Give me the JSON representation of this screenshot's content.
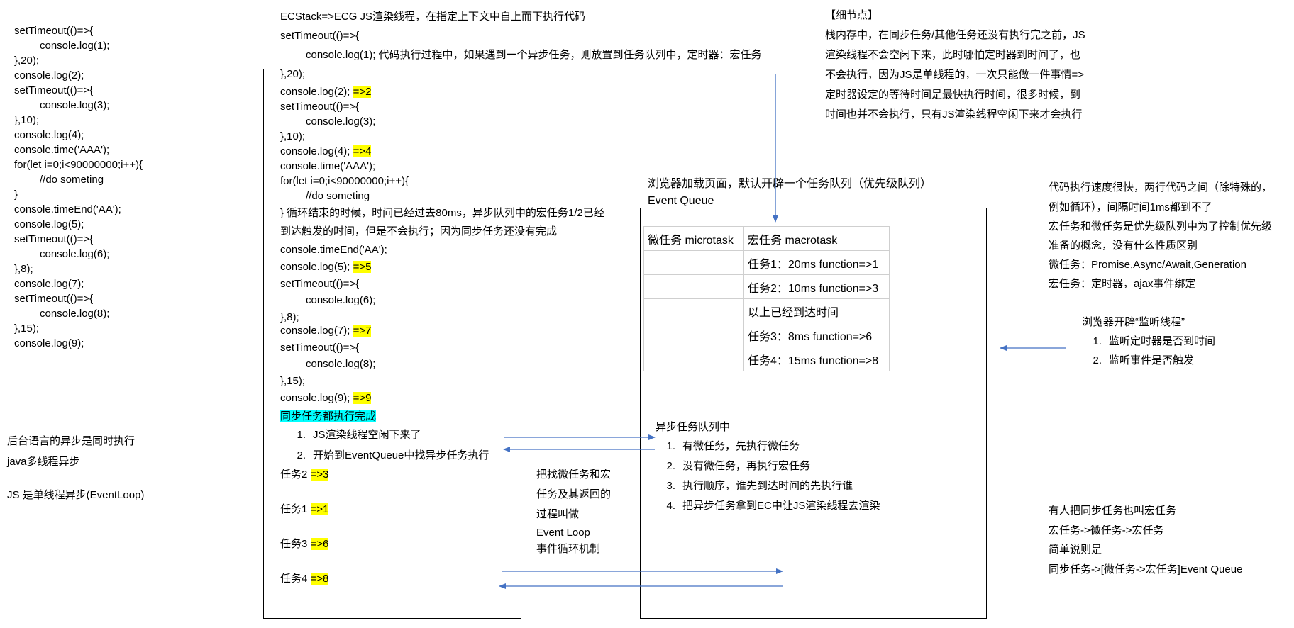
{
  "left_code": [
    "setTimeout(()=>{",
    "console.log(1);",
    "},20);",
    "console.log(2);",
    "setTimeout(()=>{",
    "console.log(3);",
    "},10);",
    "console.log(4);",
    "console.time('AAA');",
    "for(let i=0;i<90000000;i++){",
    "//do someting",
    "}",
    "console.timeEnd('AA');",
    "console.log(5);",
    "setTimeout(()=>{",
    "console.log(6);",
    "},8);",
    "console.log(7);",
    "setTimeout(()=>{",
    "console.log(8);",
    "},15);",
    "console.log(9);"
  ],
  "left_notes": {
    "line1": "后台语言的异步是同时执行",
    "line2": "java多线程异步",
    "line3": "JS 是单线程异步(EventLoop)"
  },
  "ecstack": {
    "title": "ECStack=>ECG JS渲染线程，在指定上下文中自上而下执行代码",
    "lines": {
      "l1": "setTimeout(()=>{",
      "l2": "console.log(1); 代码执行过程中，如果遇到一个异步任务，则放置到任务队列中，定时器：宏任务",
      "l3": "},20);",
      "l4": "console.log(2);",
      "l4h": "=>2",
      "l5": "setTimeout(()=>{",
      "l6": "console.log(3);",
      "l7": "},10);",
      "l8": "console.log(4);",
      "l8h": "=>4",
      "l9": "console.time('AAA');",
      "l10": "for(let i=0;i<90000000;i++){",
      "l11": "//do someting",
      "l12": "} 循环结束的时候，时间已经过去80ms，异步队列中的宏任务1/2已经",
      "l13": "到达触发的时间，但是不会执行；因为同步任务还没有完成",
      "l14": "console.timeEnd('AA');",
      "l15": "console.log(5);",
      "l15h": "=>5",
      "l16": "setTimeout(()=>{",
      "l17": "console.log(6);",
      "l18": "},8);",
      "l19": "console.log(7);",
      "l19h": "=>7",
      "l20": "setTimeout(()=>{",
      "l21": "console.log(8);",
      "l22": "},15);",
      "l23": "console.log(9);",
      "l23h": "=>9",
      "sync_done": "同步任务都执行完成",
      "step1": "JS渲染线程空闲下来了",
      "step2": "开始到EventQueue中找异步任务执行",
      "t2": "任务2",
      "t2h": "=>3",
      "t1": "任务1",
      "t1h": "=>1",
      "t3": "任务3",
      "t3h": "=>6",
      "t4": "任务4",
      "t4h": "=>8"
    }
  },
  "event_loop_note": [
    "把找微任务和宏",
    "任务及其返回的",
    "过程叫做",
    "Event Loop",
    "事件循环机制"
  ],
  "detail": {
    "title": "【细节点】",
    "lines": [
      "栈内存中，在同步任务/其他任务还没有执行完之前，JS",
      "渲染线程不会空闲下来，此时哪怕定时器到时间了，也",
      "不会执行，因为JS是单线程的，一次只能做一件事情=>",
      "定时器设定的等待时间是最快执行时间，很多时候，到",
      "时间也并不会执行，只有JS渲染线程空闲下来才会执行"
    ]
  },
  "queue": {
    "title_line1": "浏览器加载页面，默认开辟一个任务队列（优先级队列）",
    "title_line2": "Event Queue",
    "col_micro": "微任务 microtask",
    "col_macro": "宏任务 macrotask",
    "rows": [
      "任务1：20ms function=>1",
      "任务2：10ms function=>3",
      "以上已经到达时间",
      "任务3：8ms function=>6",
      "任务4：15ms function=>8"
    ],
    "async_title": "异步任务队列中",
    "async_items": [
      "有微任务，先执行微任务",
      "没有微任务，再执行宏任务",
      "执行顺序，谁先到达时间的先执行谁",
      "把异步任务拿到EC中让JS渲染线程去渲染"
    ]
  },
  "right_notes": {
    "speed": [
      "代码执行速度很快，两行代码之间（除特殊的，",
      "例如循环），间隔时间1ms都到不了",
      "宏任务和微任务是优先级队列中为了控制优先级",
      "准备的概念，没有什么性质区别",
      "微任务：Promise,Async/Await,Generation",
      "宏任务：定时器，ajax事件绑定"
    ],
    "listen_title": "浏览器开辟“监听线程”",
    "listen_items": [
      "监听定时器是否到时间",
      "监听事件是否触发"
    ],
    "bottom": [
      "有人把同步任务也叫宏任务",
      "宏任务->微任务->宏任务",
      "简单说则是",
      "同步任务->[微任务->宏任务]Event Queue"
    ]
  },
  "colors": {
    "arrow": "#4472c4",
    "highlight": "#ffff00",
    "highlight_cyan": "#00ffff"
  }
}
